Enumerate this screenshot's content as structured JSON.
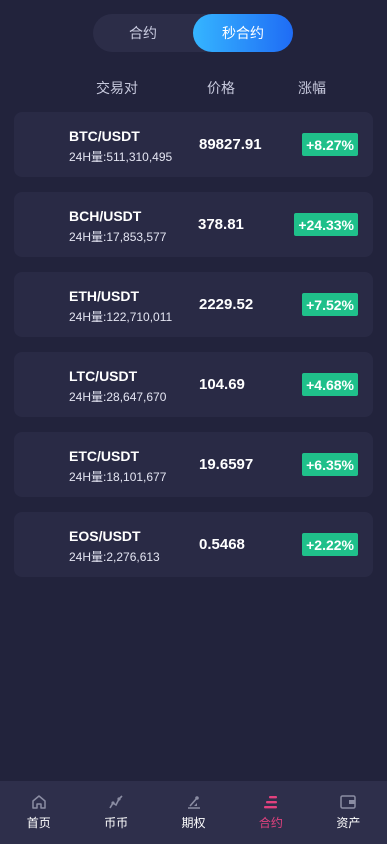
{
  "tabs": [
    {
      "label": "合约",
      "active": false
    },
    {
      "label": "秒合约",
      "active": true
    }
  ],
  "header": {
    "pair": "交易对",
    "price": "价格",
    "change": "涨幅"
  },
  "rows": [
    {
      "pair": "BTC/USDT",
      "volume": "24H量:511,310,495",
      "price": "89827.91",
      "change": "+8.27%"
    },
    {
      "pair": "BCH/USDT",
      "volume": "24H量:17,853,577",
      "price": "378.81",
      "change": "+24.33%"
    },
    {
      "pair": "ETH/USDT",
      "volume": "24H量:122,710,011",
      "price": "2229.52",
      "change": "+7.52%"
    },
    {
      "pair": "LTC/USDT",
      "volume": "24H量:28,647,670",
      "price": "104.69",
      "change": "+4.68%"
    },
    {
      "pair": "ETC/USDT",
      "volume": "24H量:18,101,677",
      "price": "19.6597",
      "change": "+6.35%"
    },
    {
      "pair": "EOS/USDT",
      "volume": "24H量:2,276,613",
      "price": "0.5468",
      "change": "+2.22%"
    }
  ],
  "nav": [
    {
      "label": "首页",
      "icon": "home-icon"
    },
    {
      "label": "币币",
      "icon": "trend-icon"
    },
    {
      "label": "期权",
      "icon": "options-icon"
    },
    {
      "label": "合约",
      "icon": "contract-icon",
      "active": true
    },
    {
      "label": "资产",
      "icon": "wallet-icon"
    }
  ],
  "colors": {
    "background": "#22233c",
    "card": "#292a45",
    "up": "#1fc08a",
    "accent": "#e2417e",
    "tab_gradient_start": "#35b5ff",
    "tab_gradient_end": "#1f6cf5"
  }
}
